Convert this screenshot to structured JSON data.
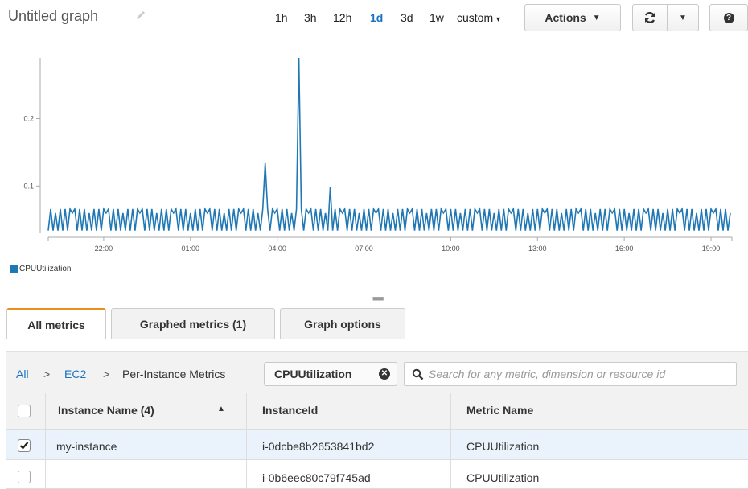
{
  "header": {
    "title": "Untitled graph",
    "time_ranges": [
      {
        "label": "1h",
        "active": false
      },
      {
        "label": "3h",
        "active": false
      },
      {
        "label": "12h",
        "active": false
      },
      {
        "label": "1d",
        "active": true
      },
      {
        "label": "3d",
        "active": false
      },
      {
        "label": "1w",
        "active": false
      },
      {
        "label": "custom",
        "active": false
      }
    ],
    "actions_label": "Actions"
  },
  "colors": {
    "series": "#1f77b4",
    "link": "#1a73c2",
    "active_tab": "#e8901c"
  },
  "chart_data": {
    "type": "line",
    "title": "",
    "xlabel": "",
    "ylabel": "",
    "x_ticks": [
      "22:00",
      "01:00",
      "04:00",
      "07:00",
      "10:00",
      "13:00",
      "16:00",
      "19:00"
    ],
    "y_ticks": [
      0.1,
      0.2
    ],
    "ylim": [
      0.03,
      0.29
    ],
    "xlim": [
      "20:05",
      "19:40"
    ],
    "legend_position": "bottom-left",
    "grid": false,
    "series": [
      {
        "name": "CPUUtilization",
        "color": "#1f77b4",
        "baseline": [
          0.034,
          0.066
        ],
        "spikes": [
          {
            "x": "03:35",
            "value": 0.134
          },
          {
            "x": "04:45",
            "value": 0.29
          },
          {
            "x": "05:50",
            "value": 0.099
          }
        ]
      }
    ]
  },
  "tabs": [
    {
      "label": "All metrics",
      "active": true
    },
    {
      "label": "Graphed metrics (1)",
      "active": false
    },
    {
      "label": "Graph options",
      "active": false
    }
  ],
  "breadcrumb": [
    "All",
    "EC2",
    "Per-Instance Metrics"
  ],
  "filter_chip": "CPUUtilization",
  "search": {
    "placeholder": "Search for any metric, dimension or resource id",
    "value": ""
  },
  "table": {
    "columns": [
      "Instance Name (4)",
      "InstanceId",
      "Metric Name"
    ],
    "rows": [
      {
        "checked": true,
        "instance_name": "my-instance",
        "instance_id": "i-0dcbe8b2653841bd2",
        "metric_name": "CPUUtilization"
      },
      {
        "checked": false,
        "instance_name": "",
        "instance_id": "i-0b6eec80c79f745ad",
        "metric_name": "CPUUtilization"
      }
    ]
  }
}
